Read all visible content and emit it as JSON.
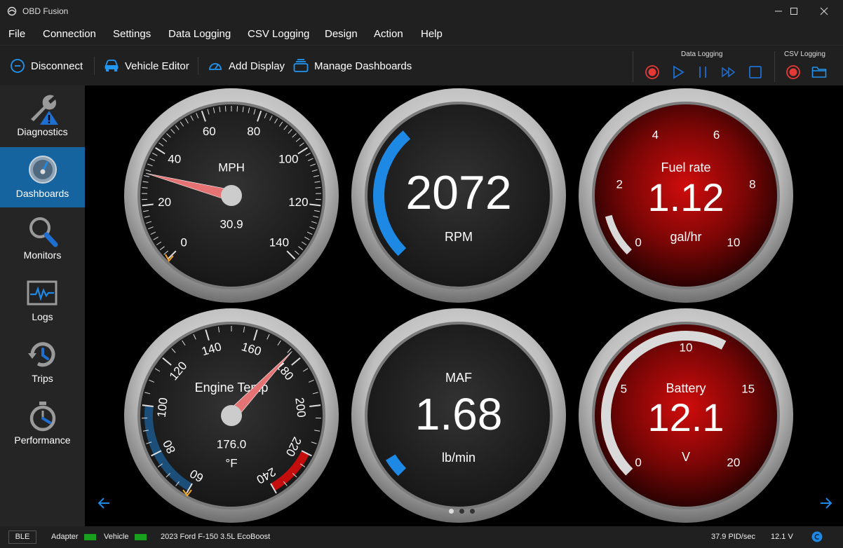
{
  "window": {
    "title": "OBD Fusion",
    "controls": [
      "minimize",
      "maximize",
      "close"
    ]
  },
  "menu": [
    "File",
    "Connection",
    "Settings",
    "Data Logging",
    "CSV Logging",
    "Design",
    "Action",
    "Help"
  ],
  "toolbar": {
    "disconnect": "Disconnect",
    "vehicle_editor": "Vehicle Editor",
    "add_display": "Add Display",
    "manage_dashboards": "Manage Dashboards",
    "data_logging_label": "Data Logging",
    "csv_logging_label": "CSV Logging"
  },
  "sidebar": [
    {
      "label": "Diagnostics",
      "icon": "wrench-warning-icon",
      "active": false
    },
    {
      "label": "Dashboards",
      "icon": "gauge-icon",
      "active": true
    },
    {
      "label": "Monitors",
      "icon": "magnifier-icon",
      "active": false
    },
    {
      "label": "Logs",
      "icon": "waveform-icon",
      "active": false
    },
    {
      "label": "Trips",
      "icon": "trip-cycle-icon",
      "active": false
    },
    {
      "label": "Performance",
      "icon": "stopwatch-icon",
      "active": false
    }
  ],
  "gauges": {
    "speed": {
      "label": "MPH",
      "value": "30.9",
      "ticks": [
        "0",
        "20",
        "40",
        "60",
        "80",
        "100",
        "120",
        "140"
      ],
      "min": 0,
      "max": 140,
      "reading": 30.9
    },
    "rpm": {
      "value": "2072",
      "unit": "RPM",
      "fill": 0.35
    },
    "fuel": {
      "label": "Fuel rate",
      "value": "1.12",
      "unit": "gal/hr",
      "ticks": [
        "0",
        "2",
        "4",
        "6",
        "8",
        "10"
      ],
      "min": 0,
      "max": 10,
      "reading": 1.12
    },
    "temp": {
      "label": "Engine Temp",
      "value": "176.0",
      "unit": "°F",
      "ticks": [
        "60",
        "80",
        "100",
        "120",
        "140",
        "160",
        "180",
        "200",
        "220",
        "240"
      ],
      "min": 60,
      "max": 240,
      "reading": 176.0
    },
    "maf": {
      "label": "MAF",
      "value": "1.68",
      "unit": "lb/min",
      "fill": 0.05
    },
    "battery": {
      "label": "Battery",
      "value": "12.1",
      "unit": "V",
      "ticks": [
        "0",
        "5",
        "10",
        "15",
        "20"
      ],
      "min": 0,
      "max": 20,
      "reading": 12.1
    }
  },
  "pager": {
    "pages": 3,
    "current": 1
  },
  "status": {
    "connection": "BLE",
    "adapter_label": "Adapter",
    "vehicle_label": "Vehicle",
    "vehicle": "2023 Ford F-150 3.5L EcoBoost",
    "pid_rate": "37.9 PID/sec",
    "voltage": "12.1 V"
  },
  "colors": {
    "accent": "#1e88e5",
    "active_nav": "#15639f",
    "led": "#18a01e",
    "redline": "#c40d0d"
  }
}
